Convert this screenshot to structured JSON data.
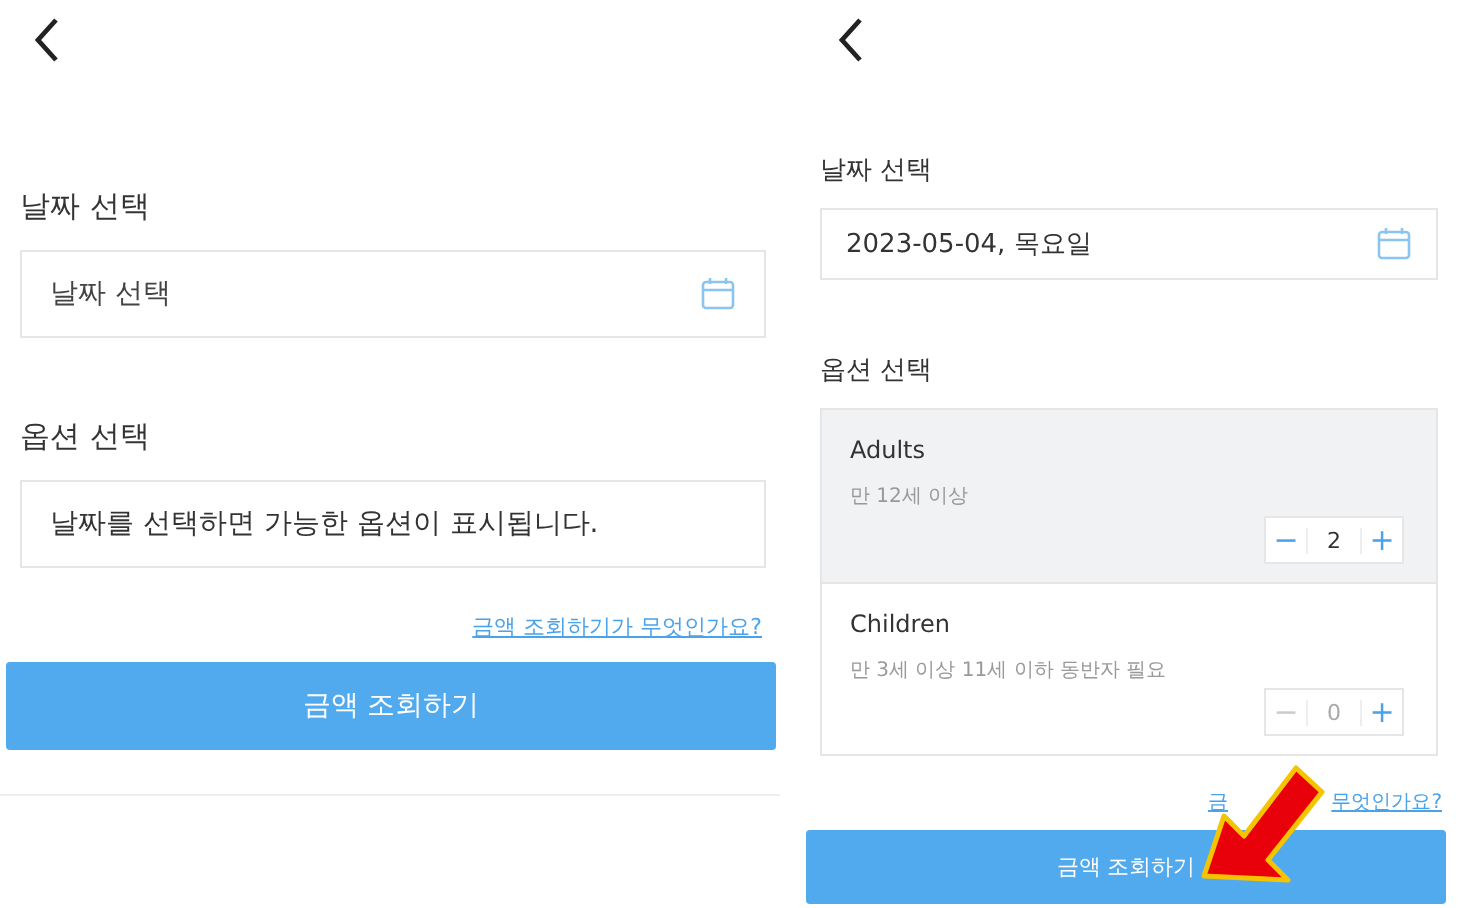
{
  "screens": [
    {
      "date_section": {
        "label": "날짜 선택",
        "field": {
          "placeholder": "날짜 선택"
        }
      },
      "option_section": {
        "label": "옵션 선택",
        "notice": "날짜를 선택하면 가능한 옵션이 표시됩니다."
      },
      "help_link": "금액 조회하기가 무엇인가요?",
      "submit_button": "금액 조회하기"
    },
    {
      "date_section": {
        "label": "날짜 선택",
        "field": {
          "value": "2023-05-04, 목요일"
        }
      },
      "option_section": {
        "label": "옵션 선택",
        "options": [
          {
            "name": "Adults",
            "description": "만 12세 이상",
            "minus": "−",
            "count": "2",
            "plus": "+",
            "selected": true,
            "minus_disabled": false
          },
          {
            "name": "Children",
            "description": "만 3세 이상 11세 이하 동반자 필요",
            "minus": "−",
            "count": "0",
            "plus": "+",
            "selected": false,
            "minus_disabled": true
          }
        ]
      },
      "help_link_parts": [
        "금",
        "무엇인가요?"
      ],
      "submit_button": "금액 조회하기",
      "pointer_arrow": true
    }
  ]
}
